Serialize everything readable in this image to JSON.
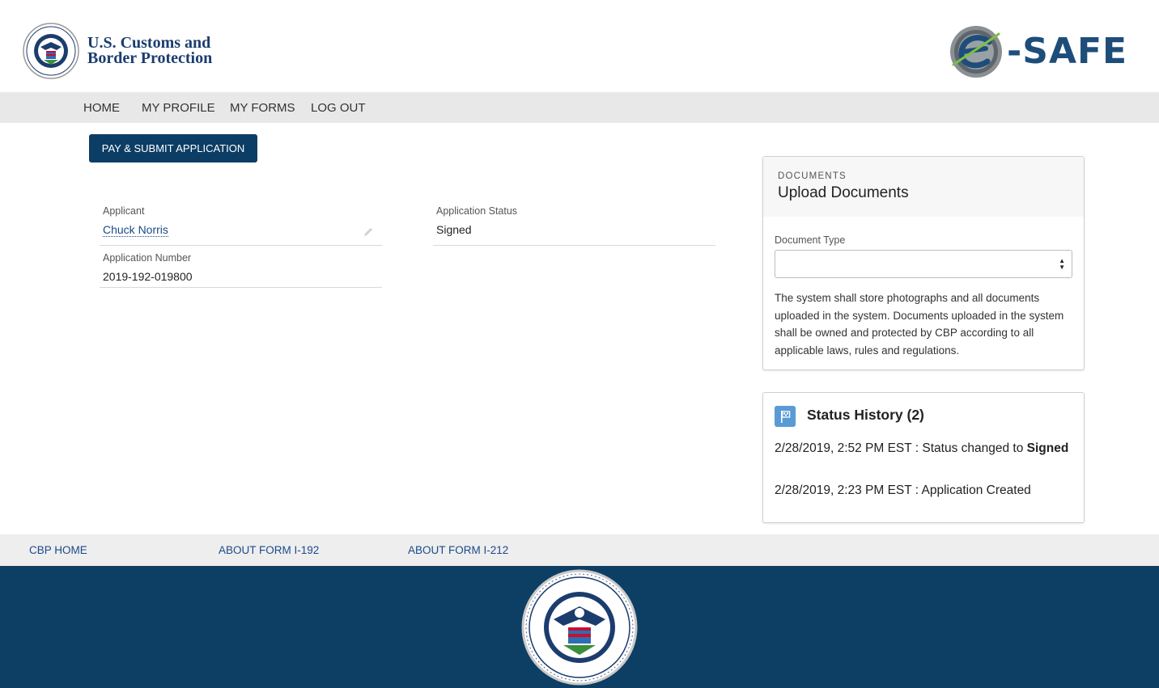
{
  "header": {
    "agency_line1": "U.S. Customs and",
    "agency_line2": "Border Protection",
    "brand_word": "-SAFE"
  },
  "nav": {
    "items": [
      {
        "label": "HOME"
      },
      {
        "label": "MY PROFILE"
      },
      {
        "label": "MY FORMS"
      },
      {
        "label": "LOG OUT"
      }
    ]
  },
  "actions": {
    "pay_submit_label": "PAY & SUBMIT APPLICATION"
  },
  "application": {
    "applicant_label": "Applicant",
    "applicant_value": "Chuck Norris",
    "number_label": "Application Number",
    "number_value": "2019-192-019800",
    "status_label": "Application Status",
    "status_value": "Signed"
  },
  "documents": {
    "eyebrow": "DOCUMENTS",
    "title": "Upload Documents",
    "type_label": "Document Type",
    "type_value": "",
    "note": "The system shall store photographs and all documents uploaded in the system. Documents uploaded in the system shall be owned and protected by CBP according to all applicable laws, rules and regulations."
  },
  "status_history": {
    "title": "Status History (2)",
    "entries": [
      {
        "prefix": "2/28/2019, 2:52 PM EST : Status changed to ",
        "emphasis": "Signed"
      },
      {
        "prefix": "2/28/2019, 2:23 PM EST : Application Created",
        "emphasis": ""
      }
    ]
  },
  "footer": {
    "links": [
      {
        "label": "CBP HOME"
      },
      {
        "label": "ABOUT FORM I-192"
      },
      {
        "label": "ABOUT FORM I-212"
      }
    ]
  },
  "colors": {
    "primary_navy": "#0c3d64",
    "footer_navy": "#0d3e63",
    "link_blue": "#1a4a8a",
    "status_icon_blue": "#5a9bd5",
    "nav_gray": "#e8e8e8"
  },
  "icons": {
    "cbp_seal": "dhs-seal-icon",
    "esafe_mark": "esafe-swoosh-icon",
    "edit": "pencil-icon",
    "select": "sort-arrows-icon",
    "status": "flag-icon",
    "footer_seal": "dhs-seal-icon"
  }
}
